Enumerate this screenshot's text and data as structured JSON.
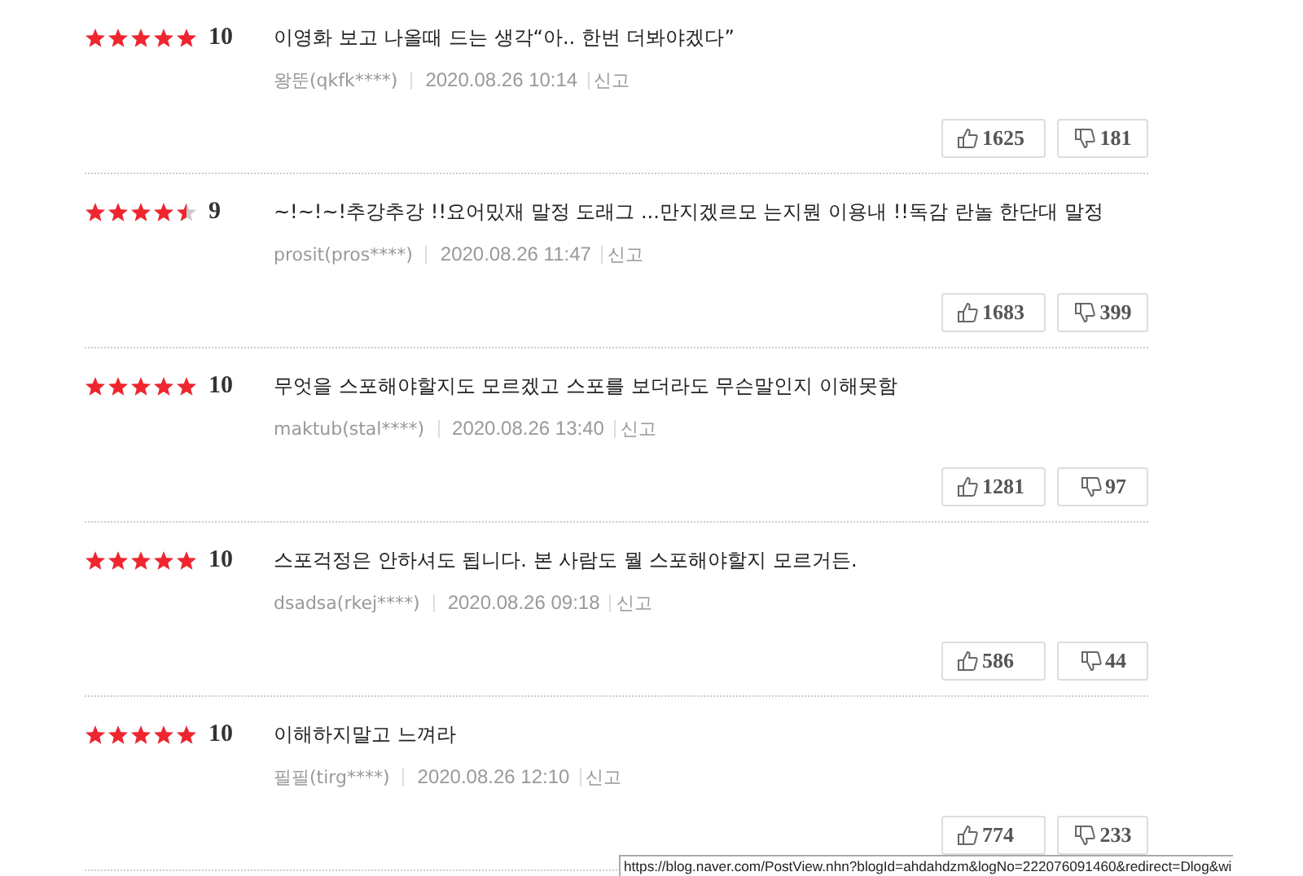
{
  "reviews": [
    {
      "stars": 5,
      "score": "10",
      "text": "이영화 보고 나올때 드는 생각“아.. 한번 더봐야겠다”",
      "author": "왕뚠(qkfk****)",
      "date": "2020.08.26 10:14",
      "report": "신고",
      "likes": "1625",
      "dislikes": "181"
    },
    {
      "stars": 4.5,
      "score": "9",
      "text": "~!~!~!추강추강 !!요어밌재 말정 도래그 ...만지겠르모 는지뭔 이용내 !!독감 란놀 한단대 말정",
      "author": "prosit(pros****)",
      "date": "2020.08.26 11:47",
      "report": "신고",
      "likes": "1683",
      "dislikes": "399"
    },
    {
      "stars": 5,
      "score": "10",
      "text": "무엇을 스포해야할지도 모르겠고 스포를 보더라도 무슨말인지 이해못함",
      "author": "maktub(stal****)",
      "date": "2020.08.26 13:40",
      "report": "신고",
      "likes": "1281",
      "dislikes": "97"
    },
    {
      "stars": 5,
      "score": "10",
      "text": "스포걱정은 안하셔도 됩니다. 본 사람도 뭘 스포해야할지 모르거든.",
      "author": "dsadsa(rkej****)",
      "date": "2020.08.26 09:18",
      "report": "신고",
      "likes": "586",
      "dislikes": "44"
    },
    {
      "stars": 5,
      "score": "10",
      "text": "이해하지말고 느껴라",
      "author": "필필(tirg****)",
      "date": "2020.08.26 12:10",
      "report": "신고",
      "likes": "774",
      "dislikes": "233"
    }
  ],
  "status_bar": {
    "url": "https://blog.naver.com/PostView.nhn?blogId=ahdahdzm&logNo=222076091460&redirect=Dlog&wi"
  }
}
